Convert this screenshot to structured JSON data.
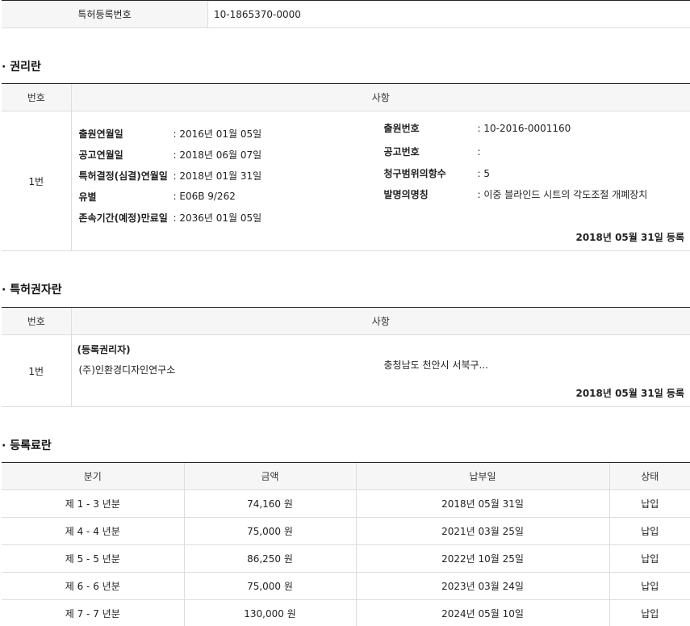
{
  "patent": {
    "label": "특허등록번호",
    "value": "10-1865370-0000"
  },
  "rights": {
    "title": "· 권리란",
    "header_no": "번호",
    "header_item": "사항",
    "row_no": "1번",
    "left": [
      {
        "label": "출원연월일",
        "value": ": 2016년 01월 05일"
      },
      {
        "label": "공고연월일",
        "value": ": 2018년 06월 07일"
      },
      {
        "label": "특허결정(심결)연월일",
        "value": ": 2018년 01월 31일"
      },
      {
        "label": "유별",
        "value": ": E06B 9/262"
      },
      {
        "label": "존속기간(예정)만료일",
        "value": ": 2036년 01월 05일"
      }
    ],
    "right": [
      {
        "label": "출원번호",
        "value": ": 10-2016-0001160"
      },
      {
        "label": "공고번호",
        "value": ":"
      },
      {
        "label": "청구범위의항수",
        "value": ": 5"
      },
      {
        "label": "발명의명칭",
        "value": ": 이중 블라인드 시트의 각도조절 개폐장치"
      }
    ],
    "footer": "2018년 05월 31일 등록"
  },
  "holders": {
    "title": "· 특허권자란",
    "header_no": "번호",
    "header_item": "사항",
    "row_no": "1번",
    "role": "(등록권리자)",
    "name": "(주)인환경디자인연구소",
    "address": "충청남도 천안시 서북구...",
    "footer": "2018년 05월 31일 등록"
  },
  "fees": {
    "title": "· 등록료란",
    "headers": [
      "분기",
      "금액",
      "납부일",
      "상태"
    ],
    "rows": [
      {
        "period": "제 1 - 3 년분",
        "amount": "74,160 원",
        "date": "2018년 05월 31일",
        "status": "납입"
      },
      {
        "period": "제 4 - 4 년분",
        "amount": "75,000 원",
        "date": "2021년 03월 25일",
        "status": "납입"
      },
      {
        "period": "제 5 - 5 년분",
        "amount": "86,250 원",
        "date": "2022년 10월 25일",
        "status": "납입"
      },
      {
        "period": "제 6 - 6 년분",
        "amount": "75,000 원",
        "date": "2023년 03월 24일",
        "status": "납입"
      },
      {
        "period": "제 7 - 7 년분",
        "amount": "130,000 원",
        "date": "2024년 05월 10일",
        "status": "납입"
      }
    ]
  }
}
